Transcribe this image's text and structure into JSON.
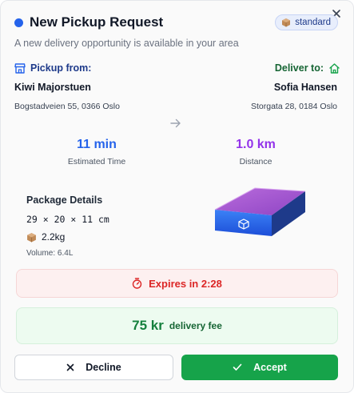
{
  "header": {
    "title": "New Pickup Request",
    "subtitle": "A new delivery opportunity is available in your area",
    "badge": "standard"
  },
  "pickup": {
    "label": "Pickup from:",
    "name": "Kiwi Majorstuen",
    "address": "Bogstadveien 55, 0366 Oslo"
  },
  "delivery": {
    "label": "Deliver to:",
    "name": "Sofia Hansen",
    "address": "Storgata 28, 0184 Oslo"
  },
  "metrics": {
    "time": {
      "value": "11 min",
      "caption": "Estimated Time"
    },
    "distance": {
      "value": "1.0 km",
      "caption": "Distance"
    }
  },
  "package": {
    "title": "Package Details",
    "dimensions": "29 × 20 × 11 cm",
    "weight": "2.2kg",
    "volume": "Volume: 6.4L"
  },
  "expires": {
    "text": "Expires in 2:28"
  },
  "fee": {
    "amount": "75 kr",
    "label": "delivery fee"
  },
  "actions": {
    "decline": "Decline",
    "accept": "Accept"
  },
  "colors": {
    "accent": "#2563eb",
    "time": "#2563eb",
    "distance": "#9333ea",
    "danger": "#dc2626",
    "success": "#16a34a"
  },
  "icons": [
    "close-icon",
    "status-dot-icon",
    "package-icon",
    "store-icon",
    "home-icon",
    "arrow-right-icon",
    "timer-icon",
    "x-icon",
    "check-icon",
    "box-3d-icon"
  ]
}
